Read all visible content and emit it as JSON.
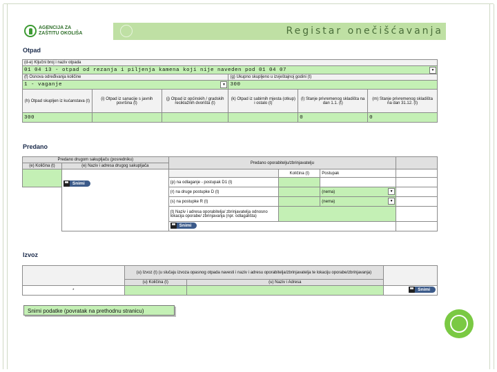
{
  "header": {
    "logo_line1": "AGENCIJA ZA",
    "logo_line2": "ZAŠTITU OKOLIŠA",
    "title": "Registar onečišćavanja"
  },
  "otpad": {
    "section_title": "Otpad",
    "key_label": "(d-e) Ključni broj i naziv otpada",
    "key_value": "01 04 13 - otpad od rezanja i piljenja kamena koji nije naveden pod 01 04 07",
    "method_label": "(f) Osnova određivanja količine",
    "method_value": "1 - vaganje",
    "total_label": "(g) Ukupno skupljeno u izvještajnoj godini (t)",
    "total_value": "300",
    "columns": [
      "(h) Otpad skupljen iz kućanstava (t)",
      "(i) Otpad iz sanacije s javnih površina (t)",
      "(j) Otpad iz općinskih / gradskih reciklažnih dvorišta (t)",
      "(k) Otpad iz sabirnih mjesta (otkup) i ostalo (t)",
      "(l) Stanje privremenog skladišta na dan 1.1. (t)",
      "(m) Stanje privremenog skladišta na dan 31.12. (t)"
    ],
    "values": [
      "300",
      "",
      "",
      "",
      "0",
      "0"
    ]
  },
  "predano": {
    "section_title": "Predano",
    "collector_header": "Predano drugom sakupljaču (posredniku)",
    "qty_header": "(e) Količina (t)",
    "name_header": "(e) Naziv i adresa drugog sakupljača",
    "processor_header": "Predano oporabitelju/zbrinjavatelju",
    "col_qty": "Količina (t)",
    "col_proc": "Postupak",
    "rows": [
      {
        "label": "(p) na odlaganje - postupak D1 (t)",
        "select": ""
      },
      {
        "label": "(r) na druge postupke D (t)",
        "select": "(nema)"
      },
      {
        "label": "(s) na postupke R (t)",
        "select": "(nema)"
      }
    ],
    "address_label": "(t) Naziv i adresa oporabitelja/ zbrinjavatelja odnosno lokacija oporabe/ zbrinjavanja (npr. odlagališta)",
    "save": "Snimi"
  },
  "izvoz": {
    "section_title": "Izvoz",
    "header": "(u) Izvoz (t) (u slučaju izvoza opasnog otpada navesti i naziv i adresu oporabitelja/zbrinjavatelja te lokaciju oporabe/zbrinjavanja)",
    "qty_header": "(u) Količina (t)",
    "name_header": "(u) Naziv i Adresa",
    "row_marker": "*",
    "save": "Snimi"
  },
  "footer": {
    "save_back": "Snimi podatke (povratak na prethodnu stranicu)"
  }
}
